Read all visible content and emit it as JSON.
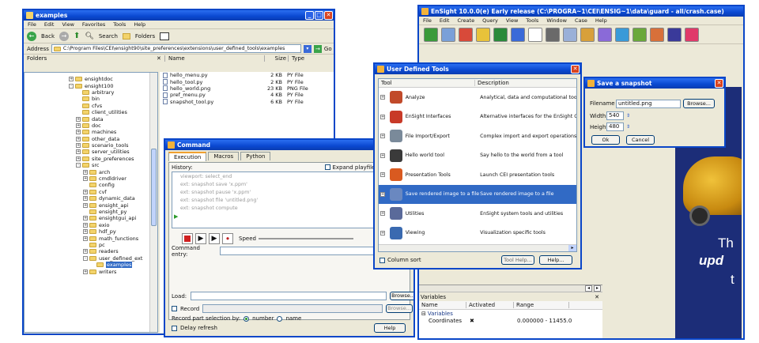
{
  "explorer": {
    "title": "examples",
    "menu": [
      "File",
      "Edit",
      "View",
      "Favorites",
      "Tools",
      "Help"
    ],
    "back_label": "Back",
    "search_label": "Search",
    "folders_label": "Folders",
    "address_label": "Address",
    "address_value": "C:\\Program Files\\CEI\\ensight90\\site_preferences\\extensions\\user_defined_tools\\examples",
    "go_label": "Go",
    "folders_header": "Folders",
    "folder_tree": [
      {
        "label": "ensightdoc",
        "indent": 0,
        "pm": "+"
      },
      {
        "label": "ensight100",
        "indent": 0,
        "pm": "-"
      },
      {
        "label": "arbitrary",
        "indent": 1,
        "pm": ""
      },
      {
        "label": "bin",
        "indent": 1,
        "pm": ""
      },
      {
        "label": "cfvs",
        "indent": 1,
        "pm": ""
      },
      {
        "label": "client_utilities",
        "indent": 1,
        "pm": ""
      },
      {
        "label": "data",
        "indent": 1,
        "pm": "+"
      },
      {
        "label": "doc",
        "indent": 1,
        "pm": "+"
      },
      {
        "label": "machines",
        "indent": 1,
        "pm": "+"
      },
      {
        "label": "other_data",
        "indent": 1,
        "pm": "+"
      },
      {
        "label": "scenario_tools",
        "indent": 1,
        "pm": "+"
      },
      {
        "label": "server_utilities",
        "indent": 1,
        "pm": "+"
      },
      {
        "label": "site_preferences",
        "indent": 1,
        "pm": "+"
      },
      {
        "label": "src",
        "indent": 1,
        "pm": "-"
      },
      {
        "label": "arch",
        "indent": 2,
        "pm": "+"
      },
      {
        "label": "cmdldriver",
        "indent": 2,
        "pm": "+"
      },
      {
        "label": "config",
        "indent": 2,
        "pm": ""
      },
      {
        "label": "cvf",
        "indent": 2,
        "pm": "+"
      },
      {
        "label": "dynamic_data",
        "indent": 2,
        "pm": "+"
      },
      {
        "label": "ensight_api",
        "indent": 2,
        "pm": "+"
      },
      {
        "label": "ensight_py",
        "indent": 2,
        "pm": ""
      },
      {
        "label": "ensightgui_api",
        "indent": 2,
        "pm": "+"
      },
      {
        "label": "exio",
        "indent": 2,
        "pm": "+"
      },
      {
        "label": "hdf_py",
        "indent": 2,
        "pm": "+"
      },
      {
        "label": "math_functions",
        "indent": 2,
        "pm": "+"
      },
      {
        "label": "pc",
        "indent": 2,
        "pm": ""
      },
      {
        "label": "readers",
        "indent": 2,
        "pm": "+"
      },
      {
        "label": "user_defined_ext",
        "indent": 2,
        "pm": "-"
      },
      {
        "label": "examples",
        "indent": 3,
        "pm": ""
      },
      {
        "label": "writers",
        "indent": 2,
        "pm": "+"
      }
    ],
    "columns": [
      "Name",
      "Size",
      "Type"
    ],
    "files": [
      {
        "name": "hello_menu.py",
        "size": "2 KB",
        "type": "PY File"
      },
      {
        "name": "hello_tool.py",
        "size": "2 KB",
        "type": "PY File"
      },
      {
        "name": "hello_world.png",
        "size": "23 KB",
        "type": "PNG File"
      },
      {
        "name": "pref_menu.py",
        "size": "4 KB",
        "type": "PY File"
      },
      {
        "name": "snapshot_tool.py",
        "size": "6 KB",
        "type": "PY File"
      }
    ]
  },
  "command": {
    "title": "Command",
    "tabs": [
      "Execution",
      "Macros",
      "Python"
    ],
    "history_label": "History:",
    "expand_label": "Expand playfiles",
    "history": [
      "viewport: select_end",
      "ext: snapshot save 'x.ppm'",
      "ext: snapshot pause 'x.ppm'",
      "ext: snapshot file 'untitled.png'",
      "ext: snapshot compute"
    ],
    "speed_label": "Speed",
    "cmd_label": "Command entry:",
    "load_label": "Load:",
    "browse_label": "Browse...",
    "record_label": "Record",
    "browse2_label": "Browse...",
    "partsel_label": "Record part selection by:",
    "opt_number": "number",
    "opt_name": "name",
    "delay_label": "Delay refresh",
    "help_label": "Help"
  },
  "ensight": {
    "title": "EnSight 10.0.0(e) Early release (C:\\PROGRA~1\\CEI\\ENSIG~1\\data\\guard - all/crash.case)",
    "menu": [
      "File",
      "Edit",
      "Create",
      "Query",
      "View",
      "Tools",
      "Window",
      "Case",
      "Help"
    ],
    "variables_label": "Variables",
    "var_columns": [
      "Name",
      "Activated",
      "Range"
    ],
    "var_group": "Variables",
    "var_row": {
      "name": "Coordinates",
      "range": "0.000000 - 11455.0"
    },
    "overlay_1": "Th",
    "overlay_2": "upd",
    "overlay_3": "t"
  },
  "udt": {
    "title": "User Defined Tools",
    "col_tool": "Tool",
    "col_desc": "Description",
    "items": [
      {
        "name": "Analyze",
        "desc": "Analytical, data and computational tools",
        "color": "#c14a2a",
        "selected": false
      },
      {
        "name": "EnSight Interfaces",
        "desc": "Alternative interfaces for the EnSight GUI",
        "color": "#c83a28",
        "selected": false
      },
      {
        "name": "File Import/Export",
        "desc": "Complex import and export operations, sh",
        "color": "#7a8a9a",
        "selected": false
      },
      {
        "name": "Hello world tool",
        "desc": "Say hello to the world from a tool",
        "color": "#3a3a3a",
        "selected": false
      },
      {
        "name": "Presentation Tools",
        "desc": "Launch CEI presentation tools",
        "color": "#d95a20",
        "selected": false
      },
      {
        "name": "Save rendered image to a file",
        "desc": "Save rendered image to a file",
        "color": "#6a88c0",
        "selected": true
      },
      {
        "name": "Utilities",
        "desc": "EnSight system tools and utilities",
        "color": "#5a6a9a",
        "selected": false
      },
      {
        "name": "Viewing",
        "desc": "Visualization specific tools",
        "color": "#3a6ab0",
        "selected": false
      }
    ],
    "column_sort": "Column sort",
    "tool_help": "Tool Help...",
    "help": "Help..."
  },
  "snapshot": {
    "title": "Save a snapshot",
    "filename_label": "Filename",
    "filename_value": "untitled.png",
    "browse_label": "Browse...",
    "width_label": "Width",
    "width_value": "540",
    "height_label": "Height",
    "height_value": "480",
    "ok_label": "Ok",
    "cancel_label": "Cancel"
  }
}
